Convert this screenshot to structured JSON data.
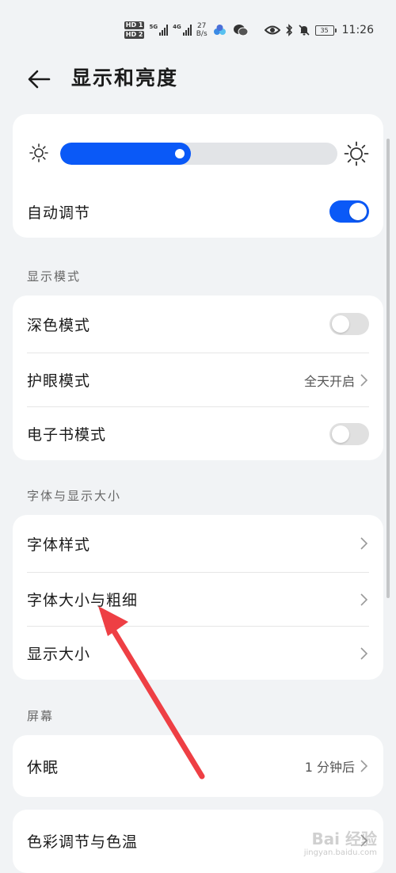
{
  "status_bar": {
    "network_5g": "5G",
    "network_4g": "4G",
    "hd1": "HD 1",
    "hd2": "HD 2",
    "speed_value": "27",
    "speed_unit": "B/s",
    "battery": "35",
    "time": "11:26"
  },
  "header": {
    "title": "显示和亮度"
  },
  "brightness": {
    "level": 0.47
  },
  "auto_adjust": {
    "label": "自动调节",
    "enabled": true
  },
  "display_mode": {
    "section_title": "显示模式",
    "dark_mode": {
      "label": "深色模式",
      "enabled": false
    },
    "eye_comfort": {
      "label": "护眼模式",
      "value": "全天开启"
    },
    "ebook_mode": {
      "label": "电子书模式",
      "enabled": false
    }
  },
  "font_display": {
    "section_title": "字体与显示大小",
    "font_style": {
      "label": "字体样式"
    },
    "font_size_weight": {
      "label": "字体大小与粗细"
    },
    "display_size": {
      "label": "显示大小"
    }
  },
  "screen": {
    "section_title": "屏幕",
    "sleep": {
      "label": "休眠",
      "value": "1 分钟后"
    },
    "color_temp": {
      "label": "色彩调节与色温"
    }
  },
  "watermark": {
    "text": "Bai 经验",
    "sub": "jingyan.baidu.com"
  },
  "colors": {
    "accent": "#0a59f7",
    "annotation_arrow": "#ee3f44"
  }
}
